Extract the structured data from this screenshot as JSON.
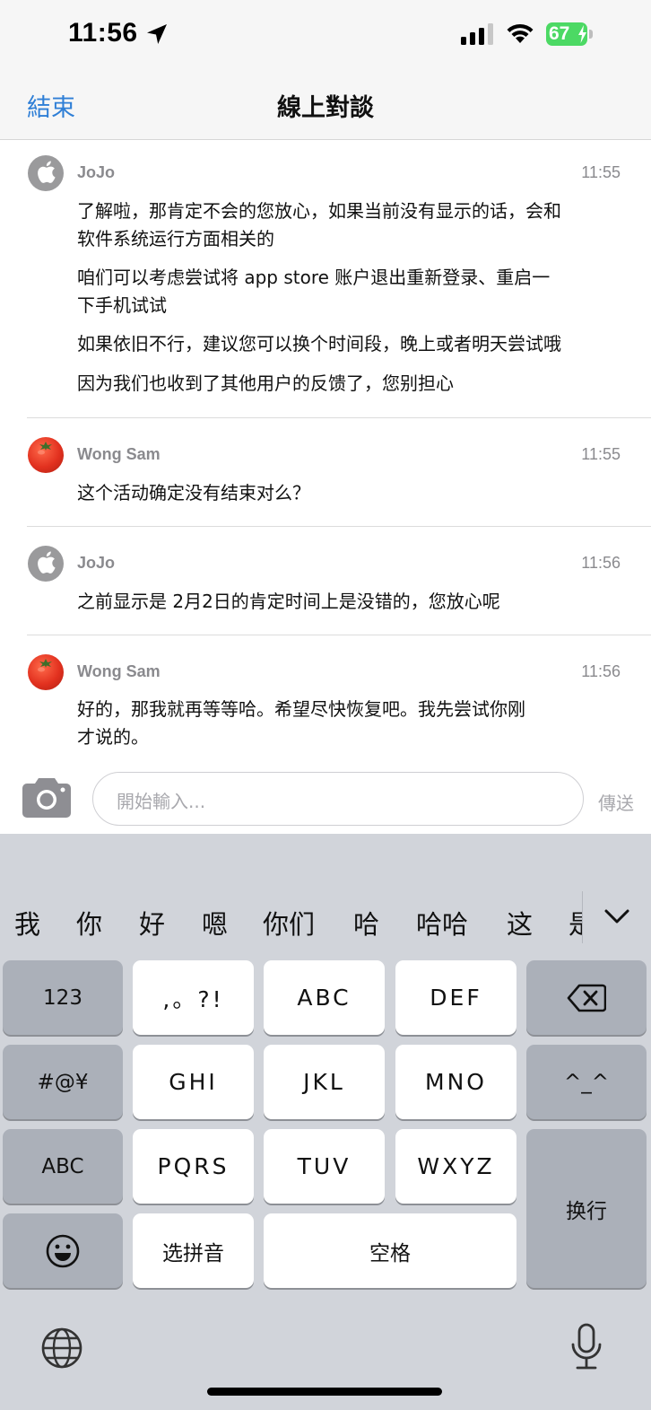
{
  "status_bar": {
    "time": "11:56",
    "battery": "67",
    "icons": [
      "location-arrow-icon",
      "cellular-signal-icon",
      "wifi-icon",
      "battery-charging-icon"
    ]
  },
  "nav": {
    "back_label": "結束",
    "title": "線上對談",
    "accent_color": "#2f7fd6"
  },
  "messages": [
    {
      "sender": "JoJo",
      "avatar": "apple-logo-icon",
      "time": "11:55",
      "lines": [
        "了解啦，那肯定不会的您放心，如果当前没有显示的话，会和",
        "软件系统运行方面相关的",
        "咱们可以考虑尝试将 app store 账户退出重新登录、重启一",
        "下手机试试",
        "如果依旧不行，建议您可以换个时间段，晚上或者明天尝试哦",
        "因为我们也收到了其他用户的反馈了，您别担心"
      ]
    },
    {
      "sender": "Wong Sam",
      "avatar": "tomato-avatar",
      "time": "11:55",
      "lines": [
        "这个活动确定没有结束对么？"
      ]
    },
    {
      "sender": "JoJo",
      "avatar": "apple-logo-icon",
      "time": "11:56",
      "lines": [
        "之前显示是 2月2日的肯定时间上是没错的，您放心呢"
      ]
    },
    {
      "sender": "Wong Sam",
      "avatar": "tomato-avatar",
      "time": "11:56",
      "lines": [
        "好的，那我就再等等哈。希望尽快恢复吧。我先尝试你刚",
        "才说的。"
      ]
    }
  ],
  "composer": {
    "placeholder": "開始輸入...",
    "send_label": "傳送"
  },
  "keyboard": {
    "candidates": [
      "我",
      "你",
      "好",
      "嗯",
      "你们",
      "哈",
      "哈哈",
      "这",
      "是"
    ],
    "keys": {
      "numbers": "123",
      "punct": ",。?!",
      "abc_row1": "ABC",
      "def": "DEF",
      "symbols": "#@¥",
      "ghi": "GHI",
      "jkl": "JKL",
      "mno": "MNO",
      "emoticon": "^_^",
      "abc_switch": "ABC",
      "pqrs": "PQRS",
      "tuv": "TUV",
      "wxyz": "WXYZ",
      "return": "换行",
      "pinyin": "选拼音",
      "space": "空格"
    }
  }
}
